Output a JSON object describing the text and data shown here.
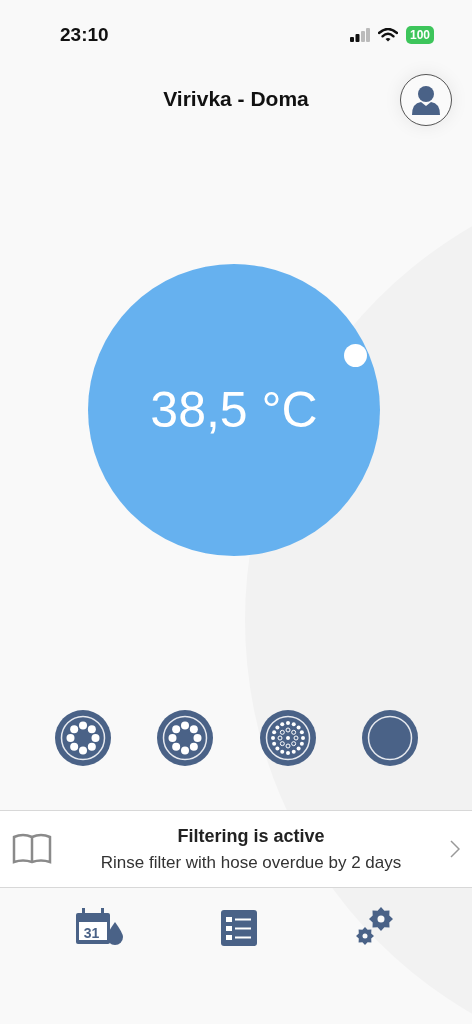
{
  "status_bar": {
    "time": "23:10",
    "battery": "100"
  },
  "header": {
    "title": "Virivka - Doma"
  },
  "thermostat": {
    "temperature": "38,5 °C"
  },
  "modes": [
    {
      "kind": "jets"
    },
    {
      "kind": "jets"
    },
    {
      "kind": "bubbles"
    },
    {
      "kind": "off"
    }
  ],
  "notice": {
    "title": "Filtering is active",
    "message": "Rinse filter with hose overdue by 2 days"
  },
  "tab_bar": {
    "calendar_day": "31"
  }
}
